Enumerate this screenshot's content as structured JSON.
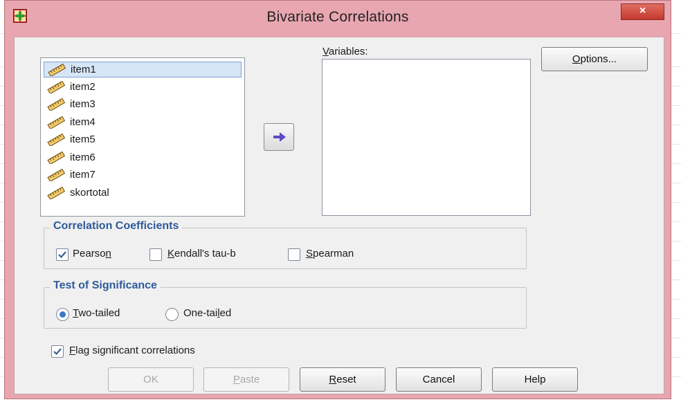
{
  "window": {
    "title": "Bivariate Correlations",
    "close_label": "×"
  },
  "variables_list": {
    "items": [
      {
        "label": "item1",
        "selected": true
      },
      {
        "label": "item2"
      },
      {
        "label": "item3"
      },
      {
        "label": "item4"
      },
      {
        "label": "item5"
      },
      {
        "label": "item6"
      },
      {
        "label": "item7"
      },
      {
        "label": "skortotal"
      }
    ]
  },
  "target": {
    "label": "Variables:",
    "items": []
  },
  "buttons": {
    "options": "Options...",
    "ok": "OK",
    "paste": "Paste",
    "reset": "Reset",
    "cancel": "Cancel",
    "help": "Help"
  },
  "correlation_coefficients": {
    "title": "Correlation Coefficients",
    "pearson": {
      "label": "Pearson",
      "checked": true
    },
    "kendall": {
      "label": "Kendall's tau-b",
      "checked": false
    },
    "spearman": {
      "label": "Spearman",
      "checked": false
    }
  },
  "test_of_significance": {
    "title": "Test of Significance",
    "two_tailed": {
      "label": "Two-tailed",
      "selected": true
    },
    "one_tailed": {
      "label": "One-tailed",
      "selected": false
    }
  },
  "flag": {
    "label": "Flag significant correlations",
    "checked": true
  },
  "colors": {
    "window_frame": "#e8a6b0",
    "group_title": "#2e5a99",
    "arrow": "#5b4bc4",
    "selection": "#d6e6f7"
  },
  "icons": {
    "variable": "ruler-icon",
    "move": "arrow-right-icon",
    "app": "spss-icon"
  }
}
